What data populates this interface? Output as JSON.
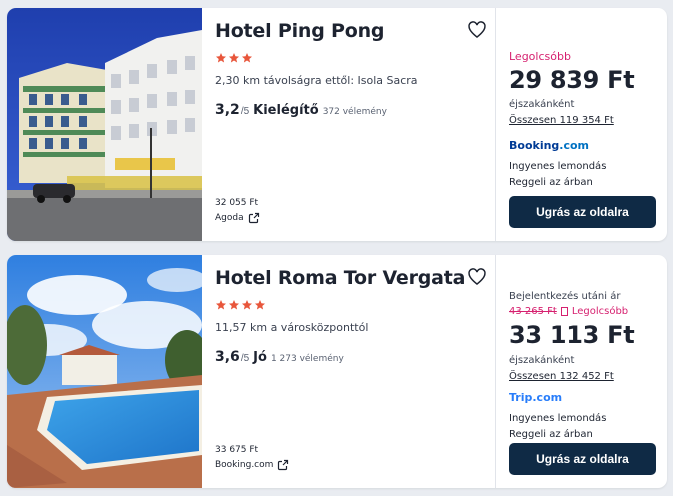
{
  "colors": {
    "accent_pink": "#d6206f",
    "button_navy": "#0f2a45",
    "star_orange": "#e8563b"
  },
  "hotels": [
    {
      "name": "Hotel Ping Pong",
      "stars": 3,
      "distance": "2,30 km távolságra ettől: Isola Sacra",
      "score": "3,2",
      "score_outof": "/5",
      "rating_word": "Kielégítő",
      "reviews": "372 vélemény",
      "alt_price": "32 055 Ft",
      "alt_provider": "Agoda",
      "cheapest_label": "Legolcsóbb",
      "price": "29 839 Ft",
      "per_night": "éjszakánként",
      "total": "Összesen 119 354 Ft",
      "provider": "Booking.com",
      "provider_part1": "Booking",
      "provider_part2": ".com",
      "feature1": "Ingyenes lemondás",
      "feature2": "Reggeli az árban",
      "button": "Ugrás az oldalra",
      "icons": [
        "heart-icon",
        "external-link-icon",
        "star-icon"
      ]
    },
    {
      "name": "Hotel Roma Tor Vergata",
      "stars": 4,
      "distance": "11,57 km a városközponttól",
      "score": "3,6",
      "score_outof": "/5",
      "rating_word": "Jó",
      "reviews": "1 273 vélemény",
      "alt_price": "33 675 Ft",
      "alt_provider": "Booking.com",
      "checkin_label": "Bejelentkezés utáni ár",
      "old_price": "43 265 Ft",
      "cheapest_label": "Legolcsóbb",
      "price": "33 113 Ft",
      "per_night": "éjszakánként",
      "total": "Összesen 132 452 Ft",
      "provider": "Trip.com",
      "feature1": "Ingyenes lemondás",
      "feature2": "Reggeli az árban",
      "button": "Ugrás az oldalra",
      "icons": [
        "heart-icon",
        "external-link-icon",
        "star-icon"
      ]
    }
  ]
}
